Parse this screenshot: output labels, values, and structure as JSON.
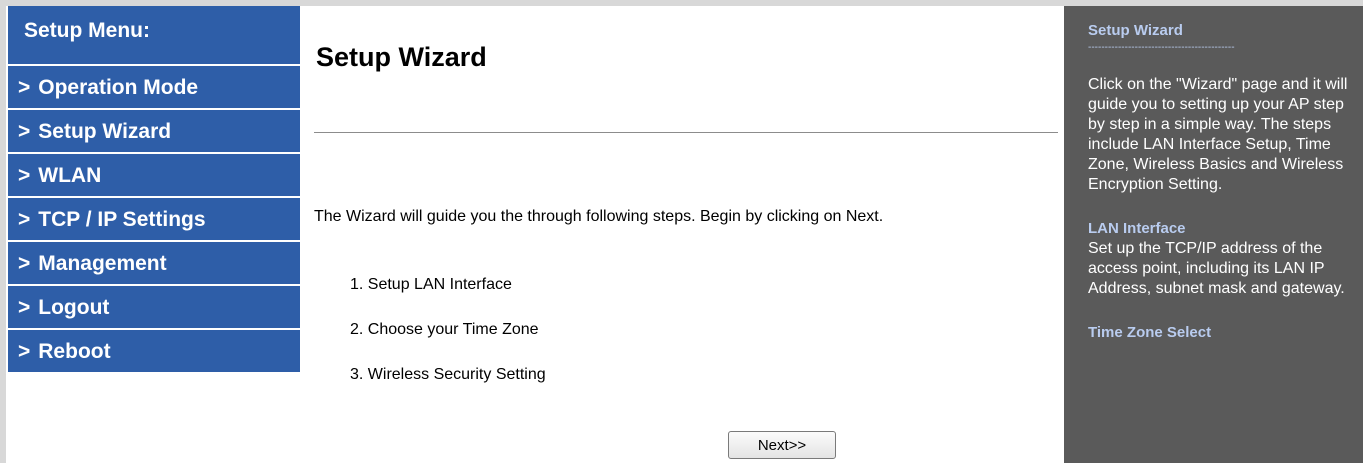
{
  "sidebar": {
    "header": "Setup Menu:",
    "items": [
      {
        "arrow": ">",
        "label": "Operation Mode"
      },
      {
        "arrow": ">",
        "label": "Setup Wizard"
      },
      {
        "arrow": ">",
        "label": "WLAN"
      },
      {
        "arrow": ">",
        "label": "TCP / IP Settings"
      },
      {
        "arrow": ">",
        "label": "Management"
      },
      {
        "arrow": ">",
        "label": "Logout"
      },
      {
        "arrow": ">",
        "label": "Reboot"
      }
    ]
  },
  "main": {
    "title": "Setup Wizard",
    "intro": "The Wizard will guide you the through following steps. Begin by clicking on Next.",
    "steps": [
      "1. Setup LAN Interface",
      "2. Choose your Time Zone",
      "3. Wireless Security Setting"
    ],
    "next_label": "Next>>"
  },
  "help": {
    "title": "Setup Wizard",
    "rule": "--------------------------------------------",
    "wizard_text": "Click on the \"Wizard\" page and it will guide you to setting up your AP step by step in a simple way. The steps include LAN Interface Setup, Time Zone, Wireless Basics and Wireless Encryption Setting.",
    "lan_heading": "LAN Interface",
    "lan_text": "Set up the TCP/IP address of the access point, including its LAN IP Address, subnet mask and gateway.",
    "tz_heading": "Time Zone Select"
  },
  "colors": {
    "menu_bg": "#2e5ea8",
    "help_bg": "#5a5a5a",
    "help_accent": "#b9ccef"
  }
}
